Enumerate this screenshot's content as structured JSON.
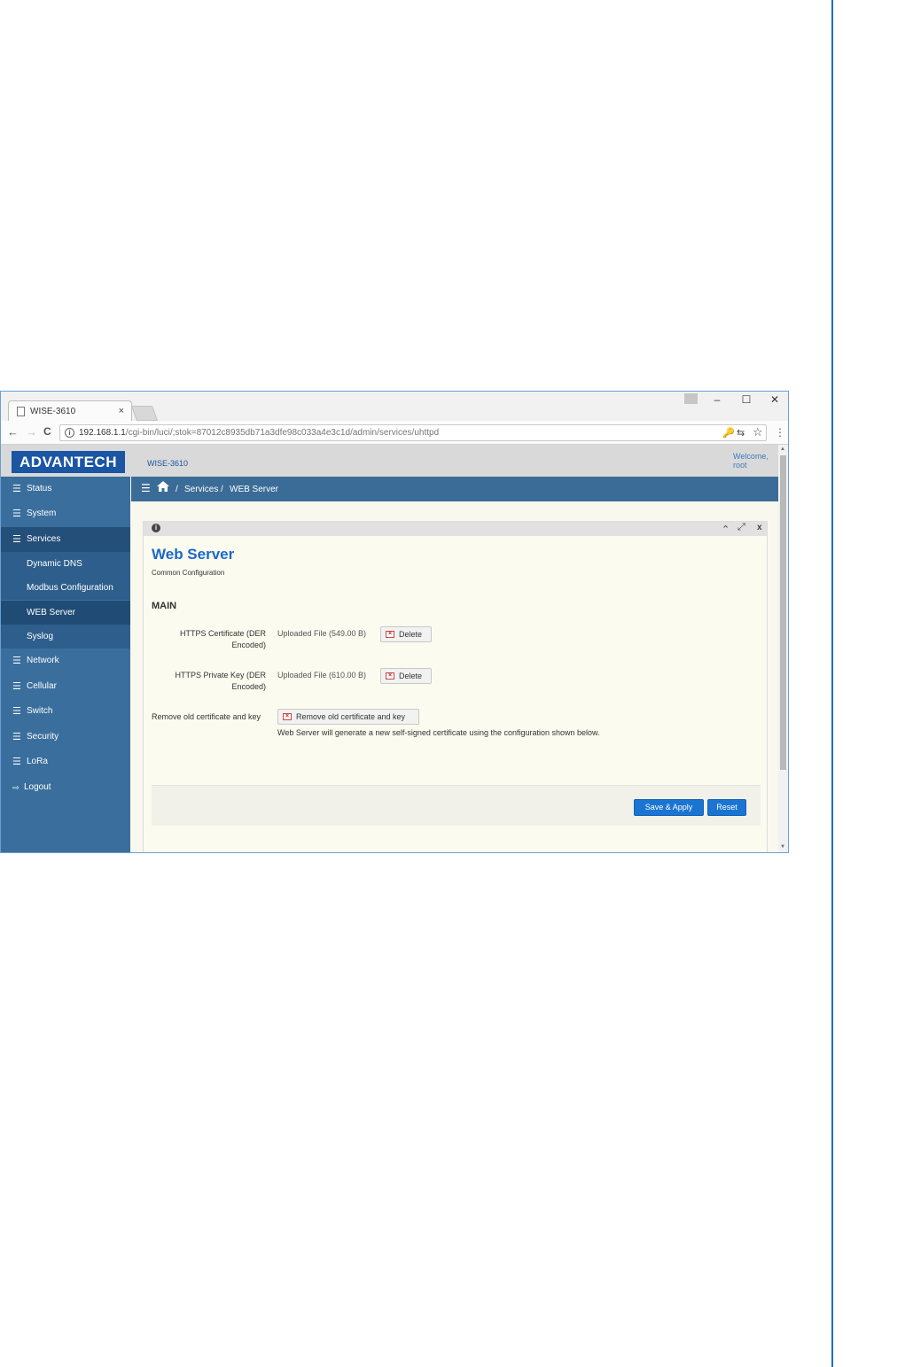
{
  "browser": {
    "tab_title": "WISE-3610",
    "tab_close": "×",
    "window_controls": {
      "minimize": "–",
      "maximize": "☐",
      "close": "✕"
    },
    "nav": {
      "back": "←",
      "forward": "→",
      "reload": "C"
    },
    "info_glyph": "i",
    "url_host": "192.168.1.1",
    "url_path": "/cgi-bin/luci/;stok=87012c8935db71a3dfe98c033a4e3c1d/admin/services/uhttpd",
    "omni_icons": {
      "key": "🔑",
      "translate": "⇆",
      "star": "☆"
    },
    "menu": "⋮"
  },
  "app": {
    "logo": "ADVANTECH",
    "model": "WISE-3610",
    "welcome_line1": "Welcome,",
    "welcome_line2": "root"
  },
  "sidebar": {
    "items": [
      {
        "label": "Status",
        "icon": "list-icon"
      },
      {
        "label": "System",
        "icon": "list-icon"
      },
      {
        "label": "Services",
        "icon": "list-icon"
      },
      {
        "label": "Network",
        "icon": "list-icon"
      },
      {
        "label": "Cellular",
        "icon": "list-icon"
      },
      {
        "label": "Switch",
        "icon": "list-icon"
      },
      {
        "label": "Security",
        "icon": "list-icon"
      },
      {
        "label": "LoRa",
        "icon": "list-icon"
      },
      {
        "label": "Logout",
        "icon": "logout-icon"
      }
    ],
    "sub_items": [
      {
        "label": "Dynamic DNS"
      },
      {
        "label": "Modbus Configuration"
      },
      {
        "label": "WEB Server"
      },
      {
        "label": "Syslog"
      }
    ]
  },
  "breadcrumb": {
    "separator": "/",
    "section": "Services",
    "page": "WEB Server"
  },
  "panel": {
    "title": "Web Server",
    "subtitle": "Common Configuration",
    "section_title": "MAIN",
    "info_glyph": "i",
    "controls": {
      "collapse": "⌃",
      "expand": "⤢",
      "close": "x"
    }
  },
  "fields": {
    "cert_label": "HTTPS Certificate (DER Encoded)",
    "cert_value": "Uploaded File (549.00 B)",
    "key_label": "HTTPS Private Key (DER Encoded)",
    "key_value": "Uploaded File (610.00 B)",
    "delete_label": "Delete",
    "remove_label": "Remove old certificate and key",
    "remove_button": "Remove old certificate and key",
    "remove_note": "Web Server will generate a new self-signed certificate using the configuration shown below."
  },
  "footer": {
    "save_apply": "Save & Apply",
    "reset": "Reset"
  },
  "colors": {
    "brand": "#1a56a4",
    "sidebar": "#3a6e9d",
    "accent_button": "#1a74d2",
    "page_rule": "#1d6fc4"
  }
}
